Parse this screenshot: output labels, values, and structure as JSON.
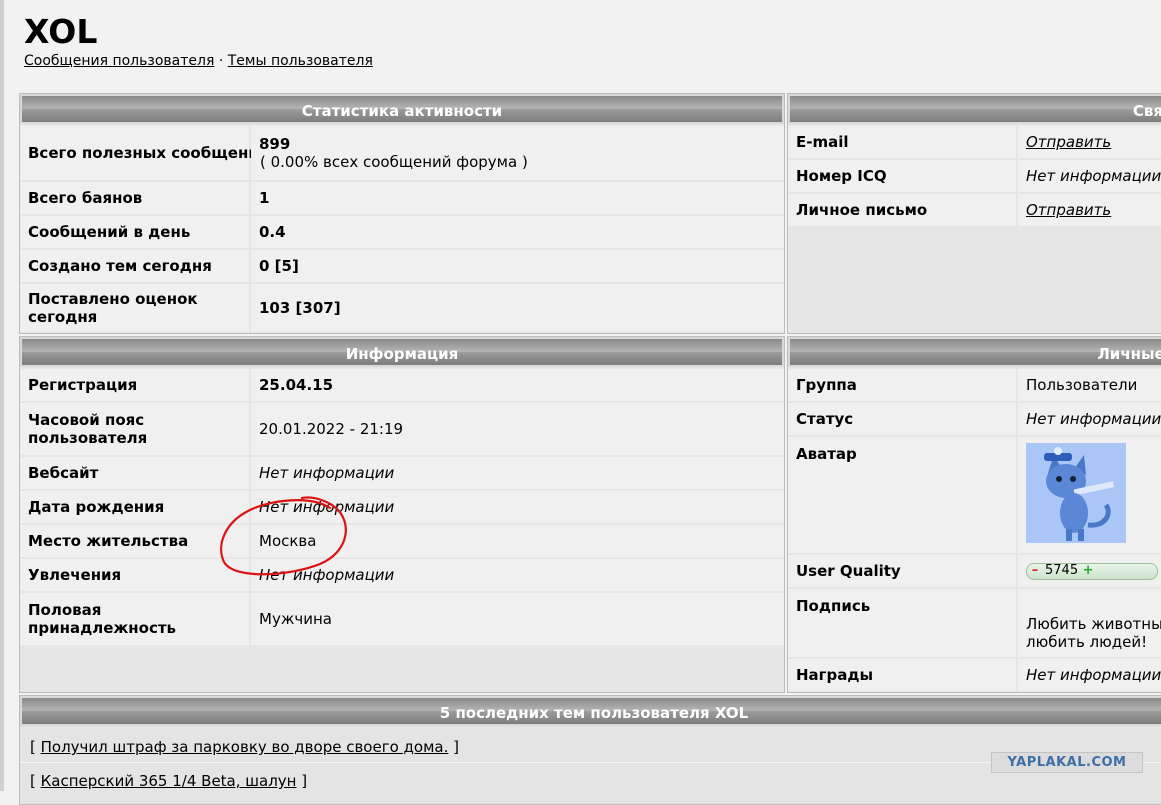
{
  "profile": {
    "username": "XOL",
    "links": {
      "messages": "Сообщения пользователя",
      "separator": "·",
      "topics": "Темы пользователя"
    }
  },
  "stats": {
    "title": "Статистика активности",
    "rows": [
      {
        "label": "Всего полезных сообщений",
        "value": "899",
        "sub": "( 0.00% всех сообщений форума )"
      },
      {
        "label": "Всего баянов",
        "value": "1"
      },
      {
        "label": "Сообщений в день",
        "value": "0.4"
      },
      {
        "label": "Создано тем сегодня",
        "value": "0 [5]"
      },
      {
        "label": "Поставлено оценок сегодня",
        "value": "103 [307]"
      }
    ]
  },
  "contact": {
    "title": "Связь",
    "rows": [
      {
        "label": "E-mail",
        "value": "Отправить"
      },
      {
        "label": "Номер ICQ",
        "value": "Нет информации"
      },
      {
        "label": "Личное письмо",
        "value": "Отправить"
      }
    ]
  },
  "info": {
    "title": "Информация",
    "rows": [
      {
        "label": "Регистрация",
        "value": "25.04.15"
      },
      {
        "label": "Часовой пояс пользователя",
        "value": "20.01.2022 - 21:19"
      },
      {
        "label": "Вебсайт",
        "value": "Нет информации"
      },
      {
        "label": "Дата рождения",
        "value": "Нет информации"
      },
      {
        "label": "Место жительства",
        "value": "Москва"
      },
      {
        "label": "Увлечения",
        "value": "Нет информации"
      },
      {
        "label": "Половая принадлежность",
        "value": "Мужчина"
      }
    ]
  },
  "personal": {
    "title": "Личные данные",
    "rows": [
      {
        "label": "Группа",
        "value": "Пользователи"
      },
      {
        "label": "Статус",
        "value": "Нет информации"
      },
      {
        "label": "Аватар"
      },
      {
        "label": "User Quality",
        "minus": "–",
        "value": "5745",
        "plus": "+"
      },
      {
        "label": "Подпись",
        "value": "Любить животных - любить людей!"
      },
      {
        "label": "Награды",
        "value": "Нет информации"
      }
    ]
  },
  "recent": {
    "title": "5 последних тем пользователя XOL",
    "topics": [
      "Получил штраф за парковку во дворе своего дома.",
      "Касперский 365 1/4 Beta, шалун"
    ]
  },
  "watermark": "YAPLAKAL.COM",
  "colors": {
    "header_gradient": "#8a8a8a",
    "annotation": "#d11",
    "quality_plus": "#2a2",
    "quality_minus": "#d22"
  }
}
